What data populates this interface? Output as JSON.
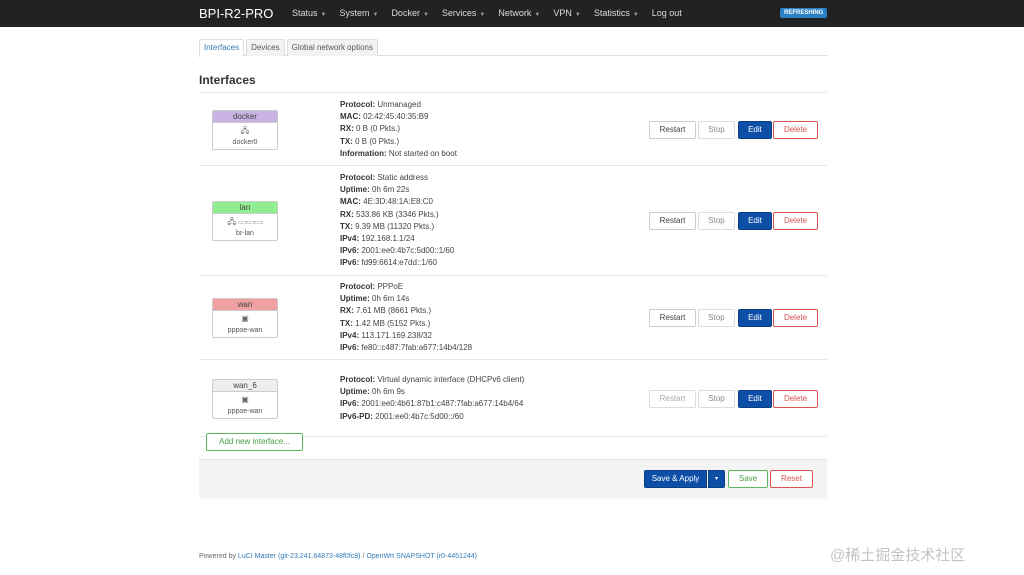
{
  "navbar": {
    "brand": "BPI-R2-PRO",
    "menu": [
      {
        "label": "Status",
        "dropdown": true
      },
      {
        "label": "System",
        "dropdown": true
      },
      {
        "label": "Docker",
        "dropdown": true
      },
      {
        "label": "Services",
        "dropdown": true
      },
      {
        "label": "Network",
        "dropdown": true
      },
      {
        "label": "VPN",
        "dropdown": true
      },
      {
        "label": "Statistics",
        "dropdown": true
      },
      {
        "label": "Log out",
        "dropdown": false
      }
    ],
    "caret": "▼",
    "status_badge": "REFRESHING",
    "status_color": "#2b80c3"
  },
  "tabs": [
    {
      "label": "Interfaces",
      "active": true
    },
    {
      "label": "Devices",
      "active": false
    },
    {
      "label": "Global network options",
      "active": false
    }
  ],
  "section_title": "Interfaces",
  "interfaces": [
    {
      "name": "docker",
      "color": "#c9b3e3",
      "icon": "ethernet-port-icon",
      "device": "docker0",
      "lines": [
        {
          "label": "Protocol:",
          "value": " Unmanaged"
        },
        {
          "label": "MAC:",
          "value": " 02:42:45:40:35:B9"
        },
        {
          "label": "RX:",
          "value": " 0 B (0 Pkts.)"
        },
        {
          "label": "TX:",
          "value": " 0 B (0 Pkts.)"
        },
        {
          "label": "Information:",
          "value": " Not started on boot"
        }
      ],
      "restart_disabled": false
    },
    {
      "name": "lan",
      "color": "#90ee90",
      "icon": "bridge-icon",
      "device": "br-lan",
      "lines": [
        {
          "label": "Protocol:",
          "value": " Static address"
        },
        {
          "label": "Uptime:",
          "value": " 0h 6m 22s"
        },
        {
          "label": "MAC:",
          "value": " 4E:3D:48:1A:E8:C0"
        },
        {
          "label": "RX:",
          "value": " 533.86 KB (3346 Pkts.)"
        },
        {
          "label": "TX:",
          "value": " 9.39 MB (11320 Pkts.)"
        },
        {
          "label": "IPv4:",
          "value": " 192.168.1.1/24"
        },
        {
          "label": "IPv6:",
          "value": " 2001:ee0:4b7c:5d00::1/60"
        },
        {
          "label": "IPv6:",
          "value": " fd99:6614:e7dd::1/60"
        }
      ],
      "restart_disabled": false
    },
    {
      "name": "wan",
      "color": "#f0a0a0",
      "icon": "tunnel-icon",
      "device": "pppoe-wan",
      "lines": [
        {
          "label": "Protocol:",
          "value": " PPPoE"
        },
        {
          "label": "Uptime:",
          "value": " 0h 6m 14s"
        },
        {
          "label": "RX:",
          "value": " 7.61 MB (8661 Pkts.)"
        },
        {
          "label": "TX:",
          "value": " 1.42 MB (5152 Pkts.)"
        },
        {
          "label": "IPv4:",
          "value": " 113.171.169.238/32"
        },
        {
          "label": "IPv6:",
          "value": " fe80::c487:7fab:a677:14b4/128"
        }
      ],
      "restart_disabled": false
    },
    {
      "name": "wan_6",
      "color": "#eeeeee",
      "icon": "tunnel-icon",
      "device": "pppoe-wan",
      "lines": [
        {
          "label": "Protocol:",
          "value": " Virtual dynamic interface (DHCPv6 client)"
        },
        {
          "label": "Uptime:",
          "value": " 0h 6m 9s"
        },
        {
          "label": "IPv6:",
          "value": " 2001:ee0:4b61:87b1:c487:7fab:a677:14b4/64"
        },
        {
          "label": "IPv6-PD:",
          "value": " 2001:ee0:4b7c:5d00::/60"
        }
      ],
      "restart_disabled": true
    }
  ],
  "row_buttons": {
    "restart": "Restart",
    "stop": "Stop",
    "edit": "Edit",
    "delete": "Delete"
  },
  "add_interface_label": "Add new interface...",
  "footer_actions": {
    "save_apply": "Save & Apply",
    "save_apply_dropdown": "▾",
    "save": "Save",
    "reset": "Reset"
  },
  "colors": {
    "navbar_bg": "#222222",
    "primary": "#0d4ea6",
    "danger": "#d9534f",
    "success": "#5cb85c"
  },
  "footer": {
    "powered_by": "Powered by ",
    "luci_link": "LuCI Master (git-23.241.64873-48f0fc8)",
    "separator": " / ",
    "openwrt_link": "OpenWrt SNAPSHOT (r0-4451244)"
  },
  "watermark": "@稀土掘金技术社区"
}
